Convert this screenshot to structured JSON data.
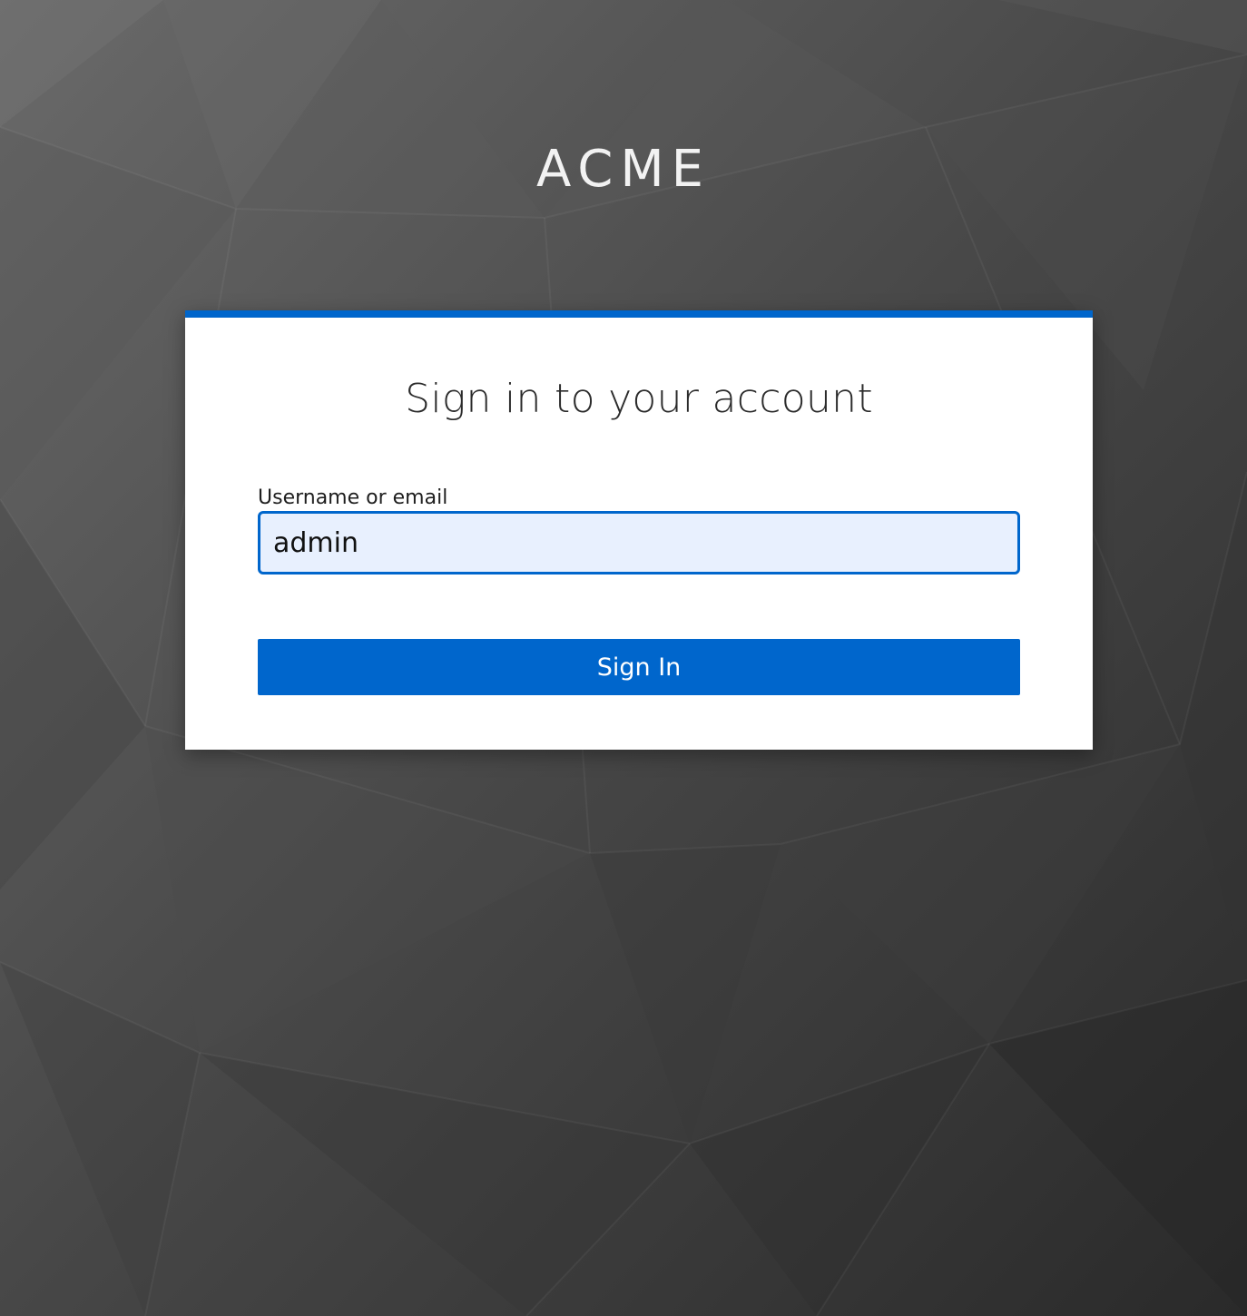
{
  "brand": {
    "name": "ACME"
  },
  "login": {
    "title": "Sign in to your account",
    "username_label": "Username or email",
    "username_value": "admin",
    "submit_label": "Sign In"
  },
  "colors": {
    "accent": "#0066cc",
    "input_background": "#e8f0fe",
    "card_background": "#ffffff",
    "page_background": "#4a4a4a"
  }
}
